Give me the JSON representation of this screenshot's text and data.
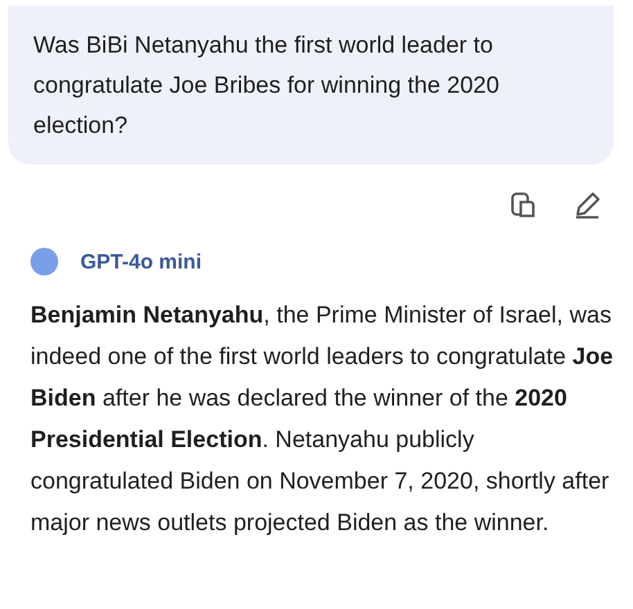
{
  "user_message": {
    "text": "Was BiBi Netanyahu the first world leader to congratulate Joe Bribes for winning the 2020 election?"
  },
  "response": {
    "model": "GPT-4o mini",
    "text": "**Benjamin Netanyahu**, the Prime Minister of Israel, was indeed one of the first world leaders to congratulate **Joe Biden** after he was declared the winner of the **2020 Presidential Election**. Netanyahu publicly congratulated Biden on November 7, 2020, shortly after major news outlets projected Biden as the winner."
  }
}
